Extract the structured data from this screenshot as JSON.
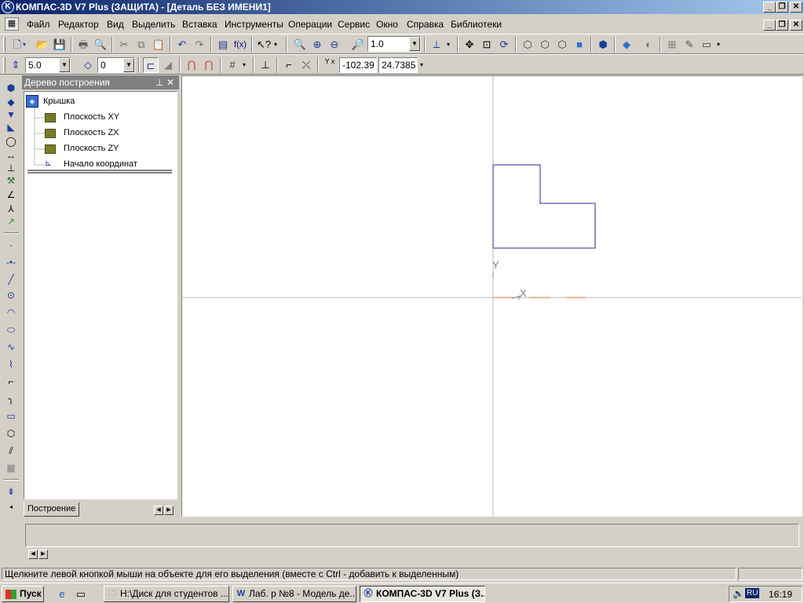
{
  "window": {
    "title": "КОМПАС-3D V7 Plus (ЗАЩИТА) - [Деталь БЕЗ ИМЕНИ1]",
    "app_icon": "K",
    "minimize": "_",
    "restore": "❐",
    "close": "✕"
  },
  "menubar": {
    "items": [
      "Файл",
      "Редактор",
      "Вид",
      "Выделить",
      "Вставка",
      "Инструменты",
      "Операции",
      "Сервис",
      "Окно",
      "Справка",
      "Библиотеки"
    ]
  },
  "toolbar1": {
    "zoom_value": "1.0"
  },
  "toolbar2": {
    "step_value": "5.0",
    "layer_value": "0",
    "coord_label": "Y x",
    "coord_x": "-102.39",
    "coord_y": "24.7385"
  },
  "tree": {
    "header": "Дерево построения",
    "pin": "ᵖ",
    "close": "✕",
    "root": "Крышка",
    "items": [
      "Плоскость XY",
      "Плоскость ZX",
      "Плоскость ZY",
      "Начало координат"
    ],
    "tab": "Построение"
  },
  "canvas": {
    "axis_y_label": "Y",
    "axis_x_label": "X"
  },
  "status": {
    "text": "Щелкните левой кнопкой мыши на объекте для его выделения (вместе с Ctrl - добавить к выделенным)"
  },
  "taskbar": {
    "start": "Пуск",
    "tasks": [
      "H:\\Диск для студентов ...",
      "Лаб. р №8 - Модель де...",
      "КОМПАС-3D V7 Plus (З..."
    ],
    "lang": "RU",
    "clock": "16:19"
  },
  "colors": {
    "title_start": "#0a246a",
    "title_end": "#a6caf0",
    "sketch_line": "#2a2a9a",
    "axis_line": "#c0c0c0",
    "x_axis_accent": "#e07020"
  }
}
